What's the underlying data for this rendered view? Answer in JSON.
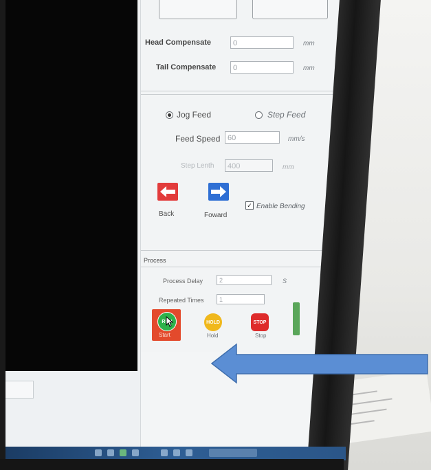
{
  "compensation": {
    "head_label": "Head Compensate",
    "head_value": "0",
    "tail_label": "Tail Compensate",
    "tail_value": "0",
    "unit": "mm"
  },
  "feed": {
    "jog_label": "Jog Feed",
    "step_label": "Step Feed",
    "selected": "Jog Feed",
    "speed_label": "Feed Speed",
    "speed_value": "60",
    "speed_unit": "mm/s",
    "step_length_label": "Step Lenth",
    "step_length_value": "400",
    "step_length_unit": "mm"
  },
  "motion": {
    "back_label": "Back",
    "forward_label": "Foward",
    "enable_bending_label": "Enable Bending",
    "enable_bending_checked": true
  },
  "process": {
    "section_label": "Process",
    "delay_label": "Process Delay",
    "delay_value": "2",
    "delay_unit": "S",
    "repeated_label": "Repeated Times",
    "repeated_value": "1",
    "start_icon_text": "RUN",
    "start_label": "Start",
    "hold_icon_text": "HOLD",
    "hold_label": "Hold",
    "stop_icon_text": "STOP",
    "stop_label": "Stop"
  },
  "colors": {
    "start_bg": "#e34a2c",
    "run_green": "#2eb24b",
    "hold_yellow": "#f0b81c",
    "stop_red": "#de2b2b",
    "back_red": "#e23b3b",
    "forward_blue": "#2f6fd4",
    "annotation_arrow": "#5b8ed4"
  }
}
